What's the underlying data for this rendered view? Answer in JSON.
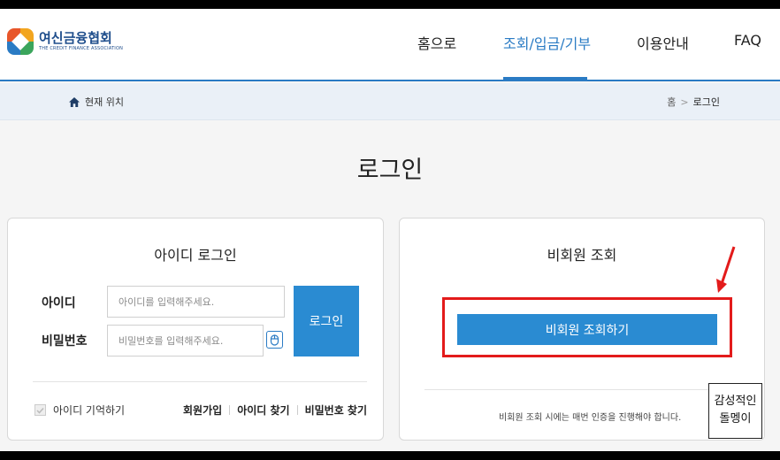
{
  "header": {
    "logo_main": "여신금융협회",
    "logo_sub": "THE CREDIT FINANCE ASSOCIATION",
    "nav": [
      "홈으로",
      "조회/입금/기부",
      "이용안내",
      "FAQ"
    ],
    "active_nav_index": 1
  },
  "breadcrumb": {
    "label": "현재 위치",
    "path": [
      "홈",
      "로그인"
    ],
    "separator": ">"
  },
  "page_title": "로그인",
  "login": {
    "title": "아이디 로그인",
    "id_label": "아이디",
    "id_placeholder": "아이디를 입력해주세요.",
    "pw_label": "비밀번호",
    "pw_placeholder": "비밀번호를 입력해주세요.",
    "login_button": "로그인",
    "remember_label": "아이디 기억하기",
    "links": [
      "회원가입",
      "아이디 찾기",
      "비밀번호 찾기"
    ]
  },
  "guest": {
    "title": "비회원 조회",
    "button": "비회원 조회하기",
    "note": "비회원 조회 시에는 매번 인증을 진행해야 합니다."
  },
  "watermark": {
    "line1": "감성적인",
    "line2": "돌멩이"
  },
  "colors": {
    "accent": "#2a7bc4",
    "button": "#2a8bd2",
    "highlight": "#e31b1b"
  }
}
